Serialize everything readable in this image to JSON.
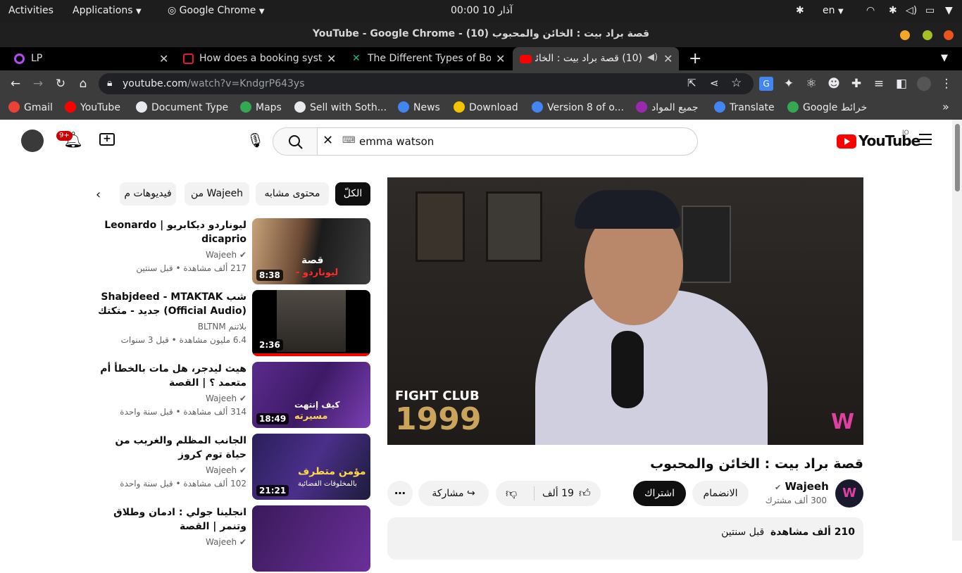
{
  "system": {
    "activities": "Activities",
    "applications": "Applications",
    "browser_app": "Google Chrome",
    "clock": "آذار 10  00:00",
    "lang": "en"
  },
  "window": {
    "title": "YouTube - Google Chrome - (10) قصة براد بيت : الخائن والمحبوب"
  },
  "tabs": [
    {
      "label": "LP"
    },
    {
      "label": "How does a booking syste"
    },
    {
      "label": "The Different Types of Bo"
    },
    {
      "label": "(10) قصة براد بيت : الخائن"
    }
  ],
  "toolbar": {
    "url_host": "youtube.com",
    "url_path": "/watch?v=KndgrP643ys"
  },
  "bookmarks": [
    {
      "label": "Gmail",
      "color": "#ea4335"
    },
    {
      "label": "YouTube",
      "color": "#ff0000"
    },
    {
      "label": "Document Type",
      "color": "#e8eaed"
    },
    {
      "label": "Maps",
      "color": "#34a853"
    },
    {
      "label": "Sell with Soth...",
      "color": "#e8eaed"
    },
    {
      "label": "News",
      "color": "#4285f4"
    },
    {
      "label": "Download",
      "color": "#f5c400"
    },
    {
      "label": "Version 8 of o...",
      "color": "#4285f4"
    },
    {
      "label": "جميع المواد",
      "color": "#9c27b0"
    },
    {
      "label": "Translate",
      "color": "#4285f4"
    },
    {
      "label": "Google خرائط",
      "color": "#34a853"
    }
  ],
  "youtube": {
    "notif_count": "9+",
    "search_value": "emma watson",
    "logo_text": "YouTube",
    "region": "JO",
    "chips": [
      "الكلّ",
      "محتوى مشابه",
      "من Wajeeh",
      "فيديوهات م"
    ],
    "video": {
      "overlay_line1": "FIGHT CLUB",
      "overlay_line2": "1999",
      "title": "قصة براد بيت : الخائن والمحبوب",
      "channel": "Wajeeh",
      "subscribers": "300 ألف مشترك",
      "join_label": "الانضمام",
      "subscribe_label": "اشتراك",
      "likes": "19 ألف",
      "share_label": "مشاركة",
      "views": "210 ألف مشاهدة",
      "date": "قبل سنتين"
    },
    "recommendations": [
      {
        "title": "ليوناردو ديكابريو | Leonardo dicaprio",
        "channel": "Wajeeh",
        "views": "217 ألف مشاهدة",
        "date": "قبل سنتين",
        "duration": "8:38",
        "verified": true
      },
      {
        "title": "Shabjdeed - MTAKTAK شب جديد - متكتك (Official Audio)",
        "channel": "بلاتنم BLTNM",
        "views": "6.4 مليون مشاهدة",
        "date": "قبل 3 سنوات",
        "duration": "2:36",
        "verified": false
      },
      {
        "title": "هيث ليدجر، هل مات بالخطأ أم متعمد ؟ | القصة",
        "channel": "Wajeeh",
        "views": "314 ألف مشاهدة",
        "date": "قبل سنة واحدة",
        "duration": "18:49",
        "verified": true
      },
      {
        "title": "الجانب المظلم والغريب من حياة توم كروز",
        "channel": "Wajeeh",
        "views": "102 ألف مشاهدة",
        "date": "قبل سنة واحدة",
        "duration": "21:21",
        "verified": true
      },
      {
        "title": "انجلينا جولي : ادمان وطلاق وتنمر | القصة",
        "channel": "Wajeeh",
        "views": "",
        "date": "",
        "duration": "",
        "verified": true
      }
    ]
  }
}
